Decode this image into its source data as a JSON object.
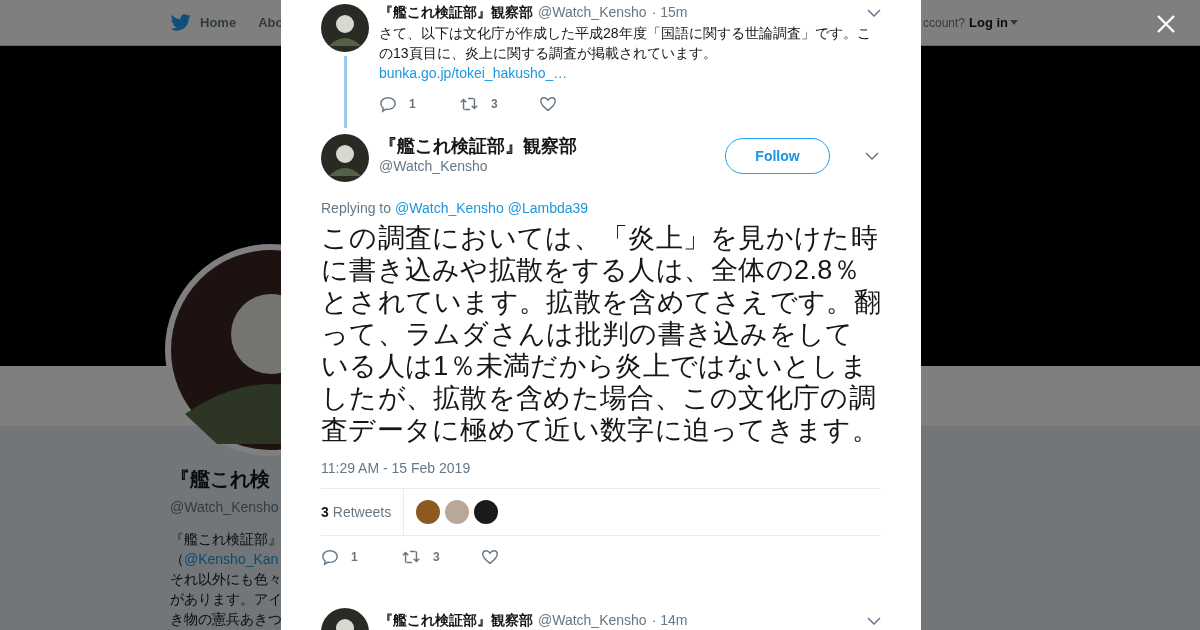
{
  "nav": {
    "items": [
      {
        "label": "Home"
      },
      {
        "label": "Abo"
      }
    ],
    "account_prompt": "ccount?",
    "login": "Log in"
  },
  "profile": {
    "name": "『艦これ検",
    "handle": "@Watch_Kensho",
    "bio_lines": [
      "『艦これ検証部』",
      "（**@Kensho_Kan**",
      "それ以外にも色々",
      "があります。アイ",
      "き物の憲兵あきつ"
    ]
  },
  "thread": [
    {
      "name": "『艦これ検証部』観察部",
      "handle": "@Watch_Kensho",
      "time": "· 15m",
      "text": "さて、以下は文化庁が作成した平成28年度「国語に関する世論調査」です。この13頁目に、炎上に関する調査が掲載されています。",
      "link": "bunka.go.jp/tokei_hakusho_…",
      "actions": [
        {
          "kind": "reply",
          "count": "1"
        },
        {
          "kind": "retweet",
          "count": "3"
        },
        {
          "kind": "like"
        }
      ]
    }
  ],
  "main_tweet": {
    "name": "『艦これ検証部』観察部",
    "handle": "@Watch_Kensho",
    "follow": "Follow",
    "replying_label": "Replying to",
    "replying_to": [
      "@Watch_Kensho",
      "@Lambda39"
    ],
    "text": "この調査においては、「炎上」を見かけた時に書き込みや拡散をする人は、全体の2.8％とされています。拡散を含めてさえです。翻って、ラムダさんは批判の書き込みをしている人は1％未満だから炎上ではないとしましたが、拡散を含めた場合、この文化庁の調査データに極めて近い数字に迫ってきます。",
    "timestamp": "11:29 AM - 15 Feb 2019",
    "retweet_count": "3",
    "retweet_label": "Retweets",
    "retweeters": [
      {
        "color": "#8a5a1e"
      },
      {
        "color": "#b8a89a"
      },
      {
        "color": "#1a1a1a"
      }
    ],
    "actions": [
      {
        "kind": "reply",
        "count": "1"
      },
      {
        "kind": "retweet",
        "count": "3"
      },
      {
        "kind": "like"
      }
    ]
  },
  "next_tweet": {
    "name": "『艦これ検証部』観察部",
    "handle": "@Watch_Kensho",
    "time": "· 14m"
  }
}
